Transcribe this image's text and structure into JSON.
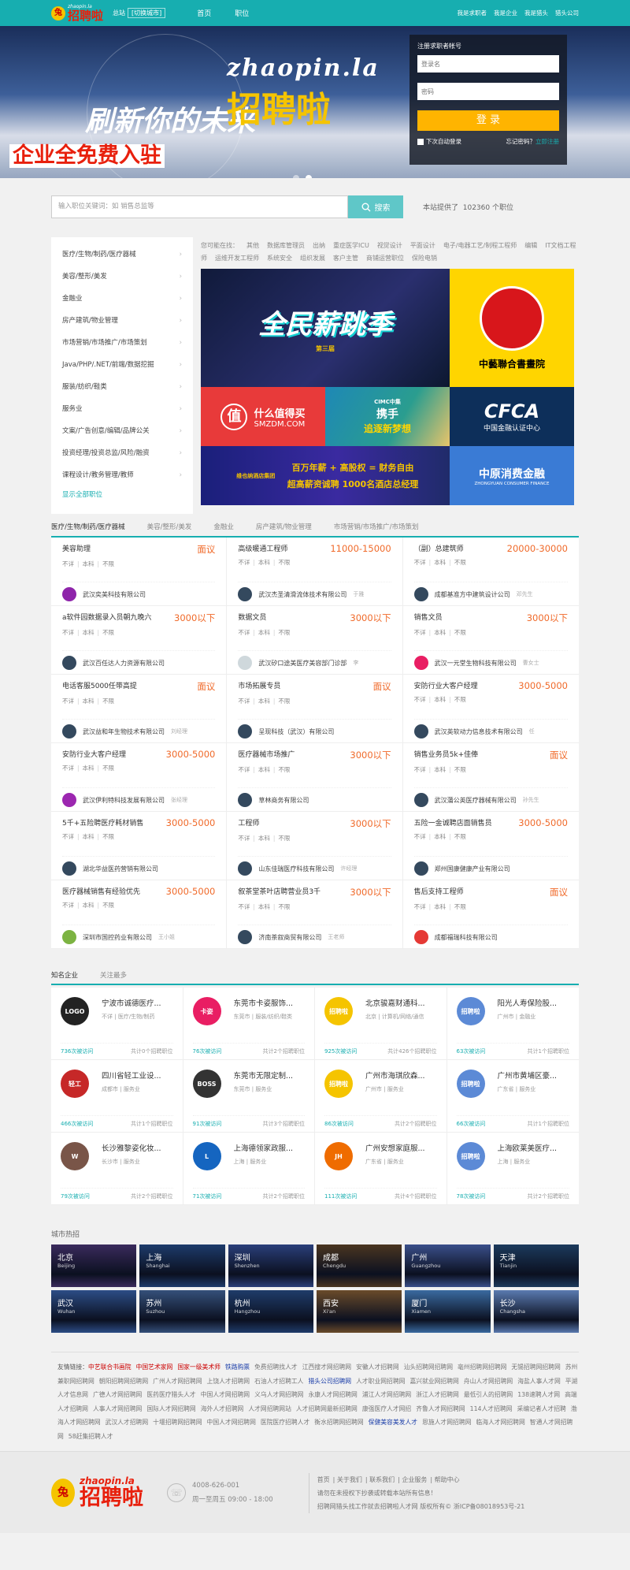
{
  "topbar": {
    "brand_en": "zhaopin.la",
    "brand_cn": "招聘啦",
    "city_prefix": "总站",
    "city_switch": "[切换城市]",
    "nav": [
      "首页",
      "职位"
    ],
    "links": [
      "我是求职者",
      "我是企业",
      "我是猎头",
      "猎头公司"
    ]
  },
  "banner": {
    "domain": "zhaopin.la",
    "slogan_a": "刷新你的未来",
    "slogan_b": "招聘啦",
    "slogan_c": "企业全免费入驻"
  },
  "login": {
    "title": "注册求职者帐号",
    "user_placeholder": "登录名",
    "pass_placeholder": "密码",
    "button": "登 录",
    "remember": "下次自动登录",
    "forgot": "忘记密码？",
    "register": "立即注册"
  },
  "search": {
    "placeholder": "输入职位关键词：如 销售总监等",
    "button": "搜索",
    "stat_prefix": "本站提供了",
    "stat_count": "102360",
    "stat_suffix": "个职位"
  },
  "categories": [
    "医疗/生物/制药/医疗器械",
    "美容/整形/美发",
    "金融业",
    "房产建筑/物业管理",
    "市场营销/市场推广/市场策划",
    "Java/PHP/.NET/前端/数据挖掘",
    "服装/纺织/鞋类",
    "服务业",
    "文案/广告创意/编辑/品牌公关",
    "投资经理/投资总监/风险/融资",
    "课程设计/教务管理/教师"
  ],
  "categories_all": "显示全部职位",
  "recommend": {
    "label": "您可能在找：",
    "items": [
      "其他",
      "数据库管理员",
      "出纳",
      "重症医学ICU",
      "视觉设计",
      "平面设计",
      "电子/电器工艺/制程工程师",
      "编辑",
      "IT文档工程师",
      "运维开发工程师",
      "系统安全",
      "组织发展",
      "客户主管",
      "商铺运营职位",
      "保险电销"
    ]
  },
  "ads": {
    "a1": "全民薪跳季",
    "a1_sub": "第三届",
    "a2": "中藝聯合書畫院",
    "a3": "什么值得买",
    "a3_sub": "SMZDM.COM",
    "a4_top": "CIMC中集",
    "a4_a": "携手",
    "a4_b": "追逐新梦想",
    "a5": "CFCA",
    "a5_sub": "中国金融认证中心",
    "a6_a": "百万年薪 + 高股权 = 财务自由",
    "a6_b": "超高薪资诚聘  1000名酒店总经理",
    "a6_logo": "维也纳酒店集团",
    "a7": "中原消费金融",
    "a7_sub": "ZHONGYUAN CONSUMER FINANCE"
  },
  "job_tabs": [
    "医疗/生物/制药/医疗器械",
    "美容/整形/美发",
    "金融业",
    "房产建筑/物业管理",
    "市场营销/市场推广/市场策划"
  ],
  "jobs": [
    {
      "title": "美容助理",
      "salary": "面议",
      "req": [
        "不详",
        "本科",
        "不限"
      ],
      "company": "武汉奕美科技有限公司",
      "contact": "",
      "logo": "#8e24aa"
    },
    {
      "title": "高级暖通工程师",
      "salary": "11000-15000",
      "req": [
        "不详",
        "本科",
        "不限"
      ],
      "company": "武汉杰圣清滑流体技术有限公司",
      "contact": "于雅",
      "logo": "#34495e"
    },
    {
      "title": "（副）总建筑师",
      "salary": "20000-30000",
      "req": [
        "不详",
        "本科",
        "不限"
      ],
      "company": "成都基准方中建筑设计公司",
      "contact": "邓先生",
      "logo": "#34495e"
    },
    {
      "title": "a软件园数据录入员朝九晚六",
      "salary": "3000以下",
      "req": [
        "不详",
        "本科",
        "不限"
      ],
      "company": "武汉百任达人力资源有限公司",
      "contact": "",
      "logo": "#34495e"
    },
    {
      "title": "数据文员",
      "salary": "3000以下",
      "req": [
        "不详",
        "本科",
        "不限"
      ],
      "company": "武汉矽口途美医疗美容部门诊部",
      "contact": "李",
      "logo": "#cfd8dc"
    },
    {
      "title": "销售文员",
      "salary": "3000以下",
      "req": [
        "不详",
        "本科",
        "不限"
      ],
      "company": "武汉一元堂生物科技有限公司",
      "contact": "曹女士",
      "logo": "#e91e63"
    },
    {
      "title": "电话客服5000任带高提",
      "salary": "面议",
      "req": [
        "不详",
        "本科",
        "不限"
      ],
      "company": "武汉益和年生物技术有限公司",
      "contact": "刘经理",
      "logo": "#34495e"
    },
    {
      "title": "市场拓展专员",
      "salary": "面议",
      "req": [
        "不详",
        "本科",
        "不限"
      ],
      "company": "呈现科技（武汉）有限公司",
      "contact": "",
      "logo": "#34495e"
    },
    {
      "title": "安防行业大客户经理",
      "salary": "3000-5000",
      "req": [
        "不详",
        "本科",
        "不限"
      ],
      "company": "武汉英软动力信息技术有限公司",
      "contact": "任",
      "logo": "#34495e"
    },
    {
      "title": "安防行业大客户经理",
      "salary": "3000-5000",
      "req": [
        "不详",
        "本科",
        "不限"
      ],
      "company": "武汉伊利特科技发展有限公司",
      "contact": "张经理",
      "logo": "#9c27b0"
    },
    {
      "title": "医疗器械市场推广",
      "salary": "3000以下",
      "req": [
        "不详",
        "本科",
        "不限"
      ],
      "company": "草林商务有限公司",
      "contact": "",
      "logo": "#34495e"
    },
    {
      "title": "销售业务员5k+佳俸",
      "salary": "面议",
      "req": [
        "不详",
        "本科",
        "不限"
      ],
      "company": "武汉蒲公英医疗器械有限公司",
      "contact": "孙先生",
      "logo": "#34495e"
    },
    {
      "title": "5千+五险聘医疗耗材销售",
      "salary": "3000-5000",
      "req": [
        "不详",
        "本科",
        "不限"
      ],
      "company": "湖北华益医药营销有限公司",
      "contact": "",
      "logo": "#34495e"
    },
    {
      "title": "工程师",
      "salary": "3000以下",
      "req": [
        "不详",
        "本科",
        "不限"
      ],
      "company": "山东佳瑞医疗科技有限公司",
      "contact": "许经理",
      "logo": "#34495e"
    },
    {
      "title": "五险一金诚聘店面销售员",
      "salary": "3000-5000",
      "req": [
        "不详",
        "本科",
        "不限"
      ],
      "company": "郑州国康健康产业有限公司",
      "contact": "",
      "logo": "#34495e"
    },
    {
      "title": "医疗器械销售有经验优先",
      "salary": "3000-5000",
      "req": [
        "不详",
        "本科",
        "不限"
      ],
      "company": "深圳市国控药业有限公司",
      "contact": "王小姐",
      "logo": "#7cb342"
    },
    {
      "title": "叙茶堂茶叶店聘营业员3千",
      "salary": "3000以下",
      "req": [
        "不详",
        "本科",
        "不限"
      ],
      "company": "济南茶叙商贸有限公司",
      "contact": "王老师",
      "logo": "#34495e"
    },
    {
      "title": "售后支持工程师",
      "salary": "面议",
      "req": [
        "不详",
        "本科",
        "不限"
      ],
      "company": "成都福瑞科技有限公司",
      "contact": "",
      "logo": "#e53935"
    }
  ],
  "famous_tabs": [
    "知名企业",
    "关注最多"
  ],
  "companies": [
    {
      "name": "宁波市诚德医疗...",
      "city": "不详",
      "industry": "医疗/生物/制药",
      "views": "736次被访问",
      "jobs": "共计0个招聘职位",
      "logo": "#222",
      "abbr": "LOGO"
    },
    {
      "name": "东莞市卡姿服饰...",
      "city": "东莞市",
      "industry": "服装/纺织/鞋类",
      "views": "76次被访问",
      "jobs": "共计2个招聘职位",
      "logo": "#e91e63",
      "abbr": "卡姿"
    },
    {
      "name": "北京骏嘉财通科...",
      "city": "北京",
      "industry": "计算机/网络/通信",
      "views": "925次被访问",
      "jobs": "共计426个招聘职位",
      "logo": "#f5c400",
      "abbr": "招聘啦"
    },
    {
      "name": "阳光人寿保险股...",
      "city": "广州市",
      "industry": "金融业",
      "views": "63次被访问",
      "jobs": "共计1个招聘职位",
      "logo": "#5c8ad6",
      "abbr": "招聘啦"
    },
    {
      "name": "四川省轻工业设...",
      "city": "成都市",
      "industry": "服务业",
      "views": "466次被访问",
      "jobs": "共计1个招聘职位",
      "logo": "#c62828",
      "abbr": "轻工"
    },
    {
      "name": "东莞市无限定制...",
      "city": "东莞市",
      "industry": "服务业",
      "views": "91次被访问",
      "jobs": "共计3个招聘职位",
      "logo": "#333",
      "abbr": "BOSS"
    },
    {
      "name": "广州市海琪欣森...",
      "city": "广州市",
      "industry": "服务业",
      "views": "86次被访问",
      "jobs": "共计2个招聘职位",
      "logo": "#f5c400",
      "abbr": "招聘啦"
    },
    {
      "name": "广州市黄埔区豪...",
      "city": "广东省",
      "industry": "服务业",
      "views": "66次被访问",
      "jobs": "共计1个招聘职位",
      "logo": "#5c8ad6",
      "abbr": "招聘啦"
    },
    {
      "name": "长沙雅黎姿化妆...",
      "city": "长沙市",
      "industry": "服务业",
      "views": "79次被访问",
      "jobs": "共计2个招聘职位",
      "logo": "#795548",
      "abbr": "W"
    },
    {
      "name": "上海德领家政服...",
      "city": "上海",
      "industry": "服务业",
      "views": "71次被访问",
      "jobs": "共计2个招聘职位",
      "logo": "#1565c0",
      "abbr": "L"
    },
    {
      "name": "广州安想家庭服...",
      "city": "广东省",
      "industry": "服务业",
      "views": "111次被访问",
      "jobs": "共计4个招聘职位",
      "logo": "#ef6c00",
      "abbr": "JH"
    },
    {
      "name": "上海欧莱美医疗...",
      "city": "上海",
      "industry": "服务业",
      "views": "78次被访问",
      "jobs": "共计2个招聘职位",
      "logo": "#5c8ad6",
      "abbr": "招聘啦"
    }
  ],
  "cities_title": "城市热招",
  "cities": [
    {
      "cn": "北京",
      "en": "Beijing",
      "bg": "#3a2a5c"
    },
    {
      "cn": "上海",
      "en": "Shanghai",
      "bg": "#1d3b6b"
    },
    {
      "cn": "深圳",
      "en": "Shenzhen",
      "bg": "#2a3f7a"
    },
    {
      "cn": "成都",
      "en": "Chengdu",
      "bg": "#4a3520"
    },
    {
      "cn": "广州",
      "en": "Guangzhou",
      "bg": "#3a4f8a"
    },
    {
      "cn": "天津",
      "en": "Tianjin",
      "bg": "#1c3a5c"
    },
    {
      "cn": "武汉",
      "en": "Wuhan",
      "bg": "#2c4d86"
    },
    {
      "cn": "苏州",
      "en": "Suzhou",
      "bg": "#35507a"
    },
    {
      "cn": "杭州",
      "en": "Hangzhou",
      "bg": "#1f3c6a"
    },
    {
      "cn": "西安",
      "en": "Xi'an",
      "bg": "#6a4b2a"
    },
    {
      "cn": "厦门",
      "en": "Xiamen",
      "bg": "#3a6aa0"
    },
    {
      "cn": "长沙",
      "en": "Changsha",
      "bg": "#5a7ab0"
    }
  ],
  "links": {
    "label": "友情链接：",
    "items": [
      {
        "t": "中艺联合书画院",
        "c": "red"
      },
      {
        "t": "中国艺术家网",
        "c": "red"
      },
      {
        "t": "国家一级美术师",
        "c": "red"
      },
      {
        "t": "铁路购票",
        "c": "blue"
      },
      {
        "t": "免费招聘找人才",
        "c": ""
      },
      {
        "t": "江西搜才网招聘网",
        "c": ""
      },
      {
        "t": "安徽人才招聘网",
        "c": ""
      },
      {
        "t": "汕头招聘网招聘网",
        "c": ""
      },
      {
        "t": "亳州招聘网招聘网",
        "c": ""
      },
      {
        "t": "无锡招聘网招聘网",
        "c": ""
      },
      {
        "t": "苏州兼职网招聘网",
        "c": ""
      },
      {
        "t": "朝阳招聘网招聘网",
        "c": ""
      },
      {
        "t": "广州人才网招聘网",
        "c": ""
      },
      {
        "t": "上饶人才招聘网",
        "c": ""
      },
      {
        "t": "石油人才招聘工人",
        "c": ""
      },
      {
        "t": "猎头公司招聘网",
        "c": "blue"
      },
      {
        "t": "人才职业网招聘网",
        "c": ""
      },
      {
        "t": "嘉兴就业网招聘网",
        "c": ""
      },
      {
        "t": "舟山人才网招聘网",
        "c": ""
      },
      {
        "t": "海盐人事人才网",
        "c": ""
      },
      {
        "t": "平湖人才信息网",
        "c": ""
      },
      {
        "t": "广德人才网招聘网",
        "c": ""
      },
      {
        "t": "医药医疗猎头人才",
        "c": ""
      },
      {
        "t": "中国人才网招聘网",
        "c": ""
      },
      {
        "t": "义乌人才网招聘网",
        "c": ""
      },
      {
        "t": "永康人才网招聘网",
        "c": ""
      },
      {
        "t": "浦江人才网招聘网",
        "c": ""
      },
      {
        "t": "浙江人才招聘网",
        "c": ""
      },
      {
        "t": "最低引人的招聘网",
        "c": ""
      },
      {
        "t": "138速聘人才网",
        "c": ""
      },
      {
        "t": "高端人才招聘网",
        "c": ""
      },
      {
        "t": "人事人才网招聘网",
        "c": ""
      },
      {
        "t": "国际人才网招聘网",
        "c": ""
      },
      {
        "t": "海外人才招聘网",
        "c": ""
      },
      {
        "t": "人才网招聘网站",
        "c": ""
      },
      {
        "t": "人才招聘网最新招聘网",
        "c": ""
      },
      {
        "t": "康强医疗人才网招",
        "c": ""
      },
      {
        "t": "齐鲁人才网招聘网",
        "c": ""
      },
      {
        "t": "114人才招聘网",
        "c": ""
      },
      {
        "t": "采编记者人才招聘",
        "c": ""
      },
      {
        "t": "渤海人才网招聘网",
        "c": ""
      },
      {
        "t": "武汉人才招聘网",
        "c": ""
      },
      {
        "t": "十堰招聘网招聘网",
        "c": ""
      },
      {
        "t": "中国人才网招聘网",
        "c": ""
      },
      {
        "t": "医院医疗招聘人才",
        "c": ""
      },
      {
        "t": "衡水招聘网招聘网",
        "c": ""
      },
      {
        "t": "保健美容美发人才",
        "c": "blue"
      },
      {
        "t": "恩施人才网招聘网",
        "c": ""
      },
      {
        "t": "临海人才网招聘网",
        "c": ""
      },
      {
        "t": "智通人才网招聘网",
        "c": ""
      },
      {
        "t": "58赶集招聘人才",
        "c": ""
      }
    ]
  },
  "footer": {
    "brand_en": "zhaopin.la",
    "brand_cn": "招聘啦",
    "phone": "4008-626-001",
    "hours": "周一至周五 09:00 - 18:00",
    "nav": [
      "首页",
      "关于我们",
      "联系我们",
      "企业服务",
      "帮助中心"
    ],
    "notice": "请勿在未授权下抄袭或转载本站所有信息！",
    "copy": "招聘网猎头找工作就去招聘啦人才网 版权所有© 浙ICP备08018953号-21"
  },
  "colors": {
    "primary": "#17aeb0",
    "salary": "#f06a2a",
    "login_button": "#ffb400"
  }
}
